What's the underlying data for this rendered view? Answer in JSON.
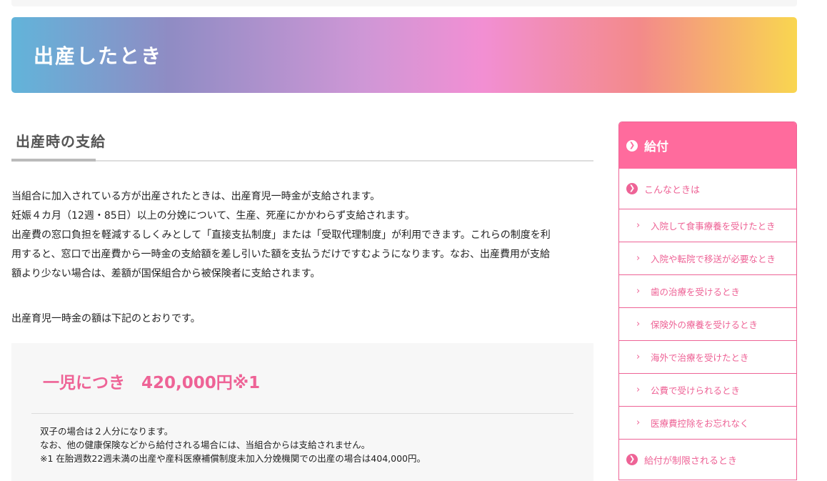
{
  "hero": {
    "title": "出産したとき"
  },
  "section": {
    "heading": "出産時の支給"
  },
  "paragraph_lines": [
    "当組合に加入されている方が出産されたときは、出産育児一時金が支給されます。",
    "妊娠４カ月（12週・85日）以上の分娩について、生産、死産にかかわらず支給されます。",
    "出産費の窓口負担を軽減するしくみとして「直接支払制度」または「受取代理制度」が利用できます。これらの制度を利",
    "用すると、窓口で出産費から一時金の支給額を差し引いた額を支払うだけですむようになります。なお、出産費用が支給",
    "額より少ない場合は、差額が国保組合から被保険者に支給されます。"
  ],
  "amount_intro": "出産育児一時金の額は下記のとおりです。",
  "benefit": {
    "amount": "一児につき　420,000円※1",
    "notes": [
      "双子の場合は２人分になります。",
      "なお、他の健康保険などから給付される場合には、当組合からは支給されません。",
      "※1 在胎週数22週未満の出産や産科医療補償制度未加入分娩機関での出産の場合は404,000円。"
    ]
  },
  "sidebar": {
    "header": "給付",
    "header_icon": "chevron-right-circle-icon",
    "category": "こんなときは",
    "items": [
      "入院して食事療養を受けたとき",
      "入院や転院で移送が必要なとき",
      "歯の治療を受けるとき",
      "保険外の療養を受けるとき",
      "海外で治療を受けたとき",
      "公費で受けられるとき",
      "医療費控除をお忘れなく"
    ],
    "last_category": "給付が制限されるとき"
  },
  "colors": {
    "accent": "#ee6396",
    "sidebar_header": "#ff6b9d"
  }
}
